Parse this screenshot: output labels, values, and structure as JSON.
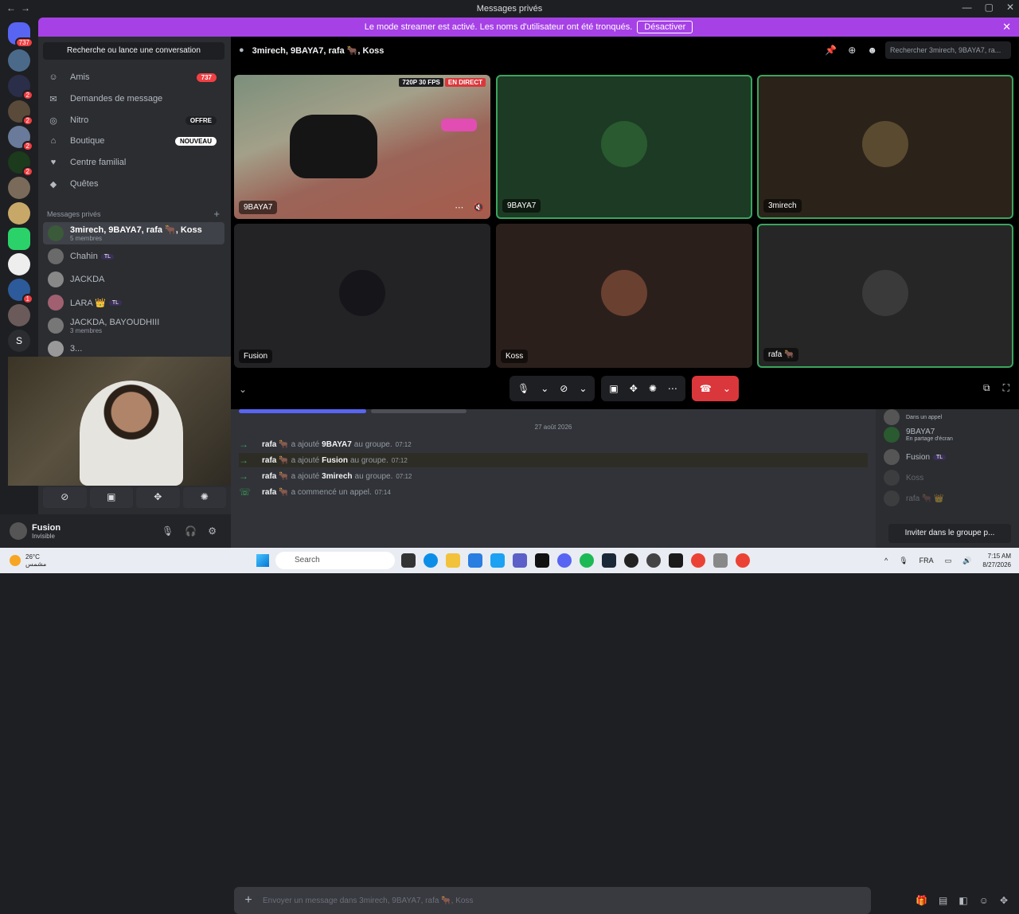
{
  "window": {
    "title": "Messages privés",
    "controls": [
      "—",
      "▢",
      "✕"
    ]
  },
  "banner": {
    "text": "Le mode streamer est activé. Les noms d'utilisateur ont été tronqués.",
    "button": "Désactiver",
    "close": "✕"
  },
  "servers": {
    "home_badge": "737",
    "badges": [
      "2",
      "2",
      "2",
      "2",
      "1"
    ],
    "letter": "S"
  },
  "sidebar": {
    "search": "Recherche ou lance une conversation",
    "nav": [
      {
        "label": "Amis",
        "pill": "737"
      },
      {
        "label": "Demandes de message",
        "pill": ""
      },
      {
        "label": "Nitro",
        "pill": "OFFRE"
      },
      {
        "label": "Boutique",
        "pill": "NOUVEAU"
      },
      {
        "label": "Centre familial",
        "pill": ""
      },
      {
        "label": "Quêtes",
        "pill": ""
      }
    ],
    "dm_header": "Messages privés",
    "dms": [
      {
        "name": "3mirech, 9BAYA7, rafa 🐂, Koss",
        "sub": "5 membres",
        "tag": ""
      },
      {
        "name": "Chahin",
        "sub": "",
        "tag": "TL"
      },
      {
        "name": "JACKDA",
        "sub": "",
        "tag": ""
      },
      {
        "name": "LARA 👑",
        "sub": "",
        "tag": "TL"
      },
      {
        "name": "JACKDA, BAYOUDHIII",
        "sub": "3 membres",
        "tag": ""
      },
      {
        "name": "3...",
        "sub": "",
        "tag": ""
      }
    ]
  },
  "user": {
    "name": "Fusion",
    "status": "Invisible"
  },
  "call": {
    "title": "3mirech, 9BAYA7, rafa 🐂, Koss",
    "search_placeholder": "Rechercher 3mirech, 9BAYA7, ra...",
    "stream_res": "720P 30 FPS",
    "stream_live": "EN DIRECT",
    "tiles": [
      {
        "label": "9BAYA7"
      },
      {
        "label": "9BAYA7"
      },
      {
        "label": "3mirech"
      },
      {
        "label": "Fusion"
      },
      {
        "label": "Koss"
      },
      {
        "label": "rafa 🐂"
      }
    ]
  },
  "chat": {
    "date": "27 août 2026",
    "messages": [
      {
        "actor": "rafa 🐂",
        "verb": "a ajouté",
        "target": "9BAYA7",
        "tail": "au groupe.",
        "time": "07:12"
      },
      {
        "actor": "rafa 🐂",
        "verb": "a ajouté",
        "target": "Fusion",
        "tail": "au groupe.",
        "time": "07:12"
      },
      {
        "actor": "rafa 🐂",
        "verb": "a ajouté",
        "target": "3mirech",
        "tail": "au groupe.",
        "time": "07:12"
      },
      {
        "actor": "rafa 🐂",
        "verb": "a commencé un appel.",
        "target": "",
        "tail": "",
        "time": "07:14"
      }
    ],
    "composer_placeholder": "Envoyer un message dans 3mirech, 9BAYA7, rafa 🐂, Koss"
  },
  "members": [
    {
      "name": "",
      "status": "Dans un appel"
    },
    {
      "name": "9BAYA7",
      "status": "En partage d'écran"
    },
    {
      "name": "Fusion",
      "status": "",
      "tag": "TL"
    },
    {
      "name": "Koss",
      "status": ""
    },
    {
      "name": "rafa 🐂 👑",
      "status": ""
    }
  ],
  "invite_button": "Inviter dans le groupe p...",
  "taskbar": {
    "temp": "26°C",
    "weather_text": "مشمس",
    "search": "Search",
    "lang": "FRA",
    "time": "7:15 AM",
    "date": "8/27/2026"
  }
}
